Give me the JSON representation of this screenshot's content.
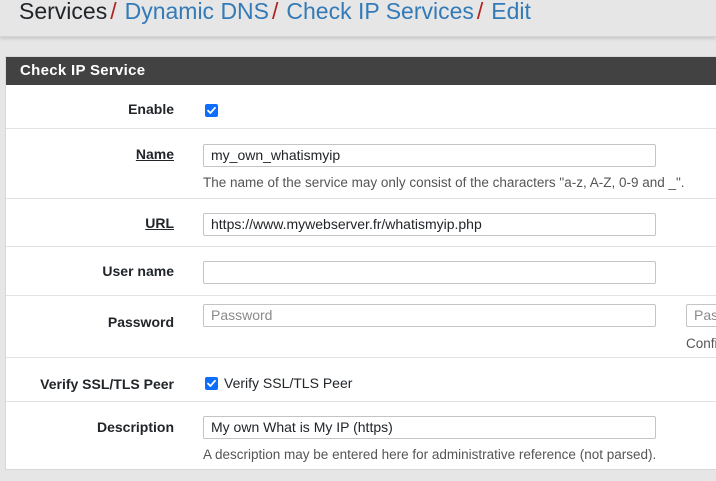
{
  "breadcrumb": {
    "root": "Services",
    "items": [
      "Dynamic DNS",
      "Check IP Services",
      "Edit"
    ],
    "separator": "/"
  },
  "panel": {
    "title": "Check IP Service"
  },
  "form": {
    "enable": {
      "label": "Enable",
      "checked": true
    },
    "name": {
      "label": "Name",
      "value": "my_own_whatismyip",
      "help": "The name of the service may only consist of the characters \"a-z, A-Z, 0-9 and _\"."
    },
    "url": {
      "label": "URL",
      "value": "https://www.mywebserver.fr/whatismyip.php"
    },
    "username": {
      "label": "User name",
      "value": ""
    },
    "password": {
      "label": "Password",
      "placeholder": "Password",
      "confirm_placeholder": "Pas",
      "confirm_help": "Confi"
    },
    "verify_ssl": {
      "label": "Verify SSL/TLS Peer",
      "checkbox_label": "Verify SSL/TLS Peer",
      "checked": true
    },
    "description": {
      "label": "Description",
      "value": "My own What  is My IP (https)",
      "help": "A description may be entered here for administrative reference (not parsed)."
    }
  },
  "colors": {
    "heading_bg": "#424242",
    "link": "#337ab7",
    "separator": "#b22222",
    "checkbox": "#0d6efd"
  }
}
